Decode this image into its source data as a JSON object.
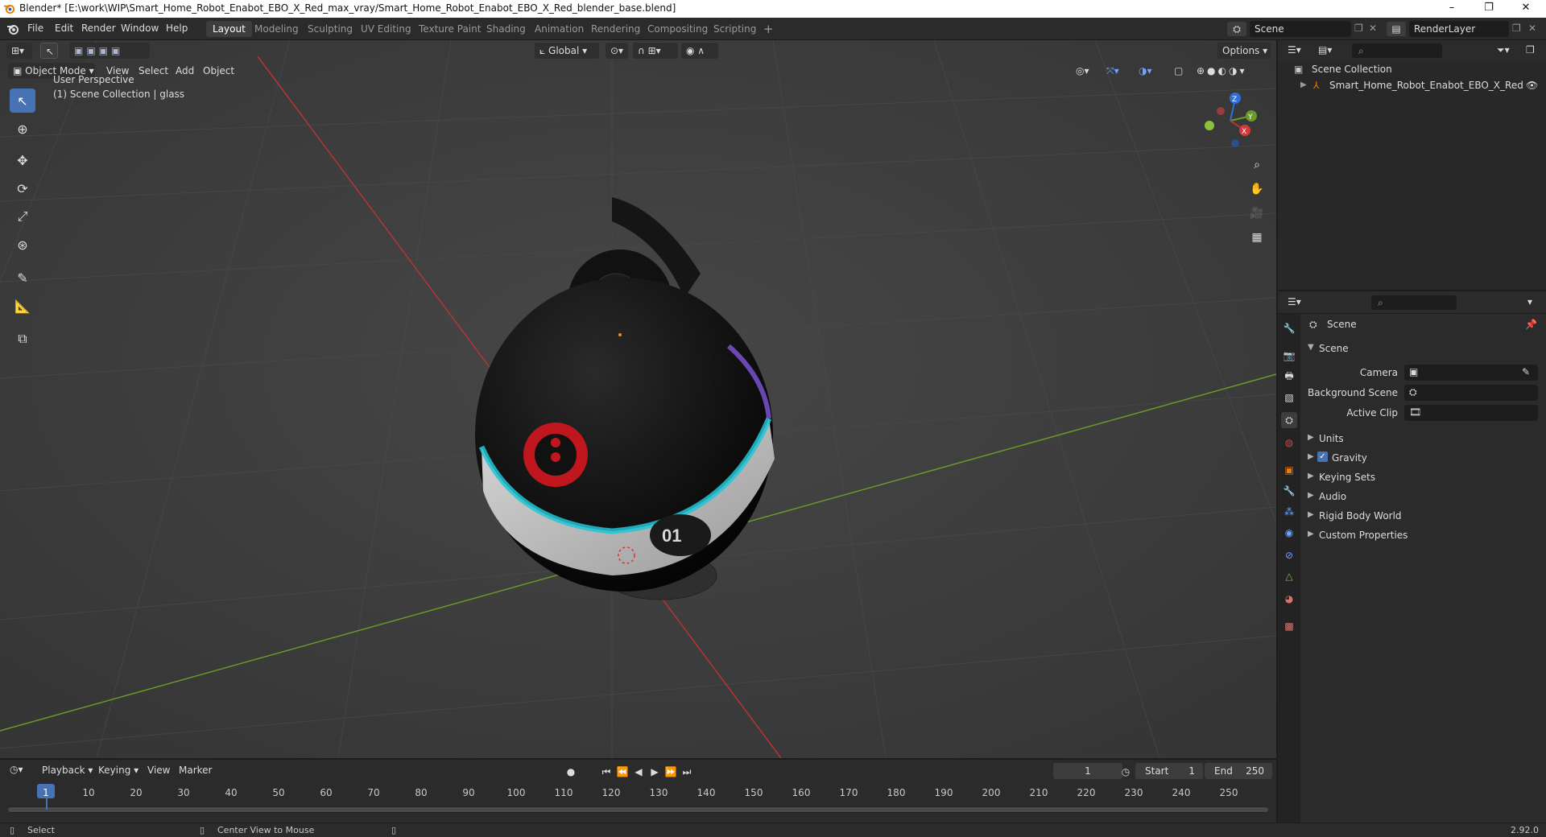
{
  "window": {
    "title": "Blender* [E:\\work\\WIP\\Smart_Home_Robot_Enabot_EBO_X_Red_max_vray/Smart_Home_Robot_Enabot_EBO_X_Red_blender_base.blend]",
    "minimize": "–",
    "restore": "❐",
    "close": "✕"
  },
  "menu": {
    "file": "File",
    "edit": "Edit",
    "render": "Render",
    "window": "Window",
    "help": "Help"
  },
  "workspaces": [
    "Layout",
    "Modeling",
    "Sculpting",
    "UV Editing",
    "Texture Paint",
    "Shading",
    "Animation",
    "Rendering",
    "Compositing",
    "Scripting"
  ],
  "workspace_add": "+",
  "scene_selector": "Scene",
  "render_layer": "RenderLayer",
  "viewport": {
    "transform_orientation": "Global",
    "options": "Options",
    "mode": "Object Mode",
    "view": "View",
    "select": "Select",
    "add": "Add",
    "object": "Object",
    "perspective": "User Perspective",
    "collection_info": "(1) Scene Collection | glass"
  },
  "gizmo": {
    "z": "Z",
    "y": "Y",
    "x": "X"
  },
  "outliner": {
    "root": "Scene Collection",
    "item": "Smart_Home_Robot_Enabot_EBO_X_Red"
  },
  "properties": {
    "context": "Scene",
    "panel": "Scene",
    "camera_label": "Camera",
    "background_scene_label": "Background Scene",
    "active_clip_label": "Active Clip",
    "sections": [
      "Units",
      "Gravity",
      "Keying Sets",
      "Audio",
      "Rigid Body World",
      "Custom Properties"
    ],
    "gravity_checked": true
  },
  "timeline": {
    "playback": "Playback",
    "keying": "Keying",
    "view": "View",
    "marker": "Marker",
    "current_frame": "1",
    "start_label": "Start",
    "start": "1",
    "end_label": "End",
    "end": "250",
    "ticks": [
      "1",
      "10",
      "20",
      "30",
      "40",
      "50",
      "60",
      "70",
      "80",
      "90",
      "100",
      "110",
      "120",
      "130",
      "140",
      "150",
      "160",
      "170",
      "180",
      "190",
      "200",
      "210",
      "220",
      "230",
      "240",
      "250"
    ]
  },
  "status": {
    "select": "Select",
    "center_view": "Center View to Mouse",
    "version": "2.92.0"
  },
  "colors": {
    "accent": "#4772b3",
    "x_axis": "#b53535",
    "y_axis": "#6a9a2a",
    "z_axis": "#2f6fd6"
  }
}
